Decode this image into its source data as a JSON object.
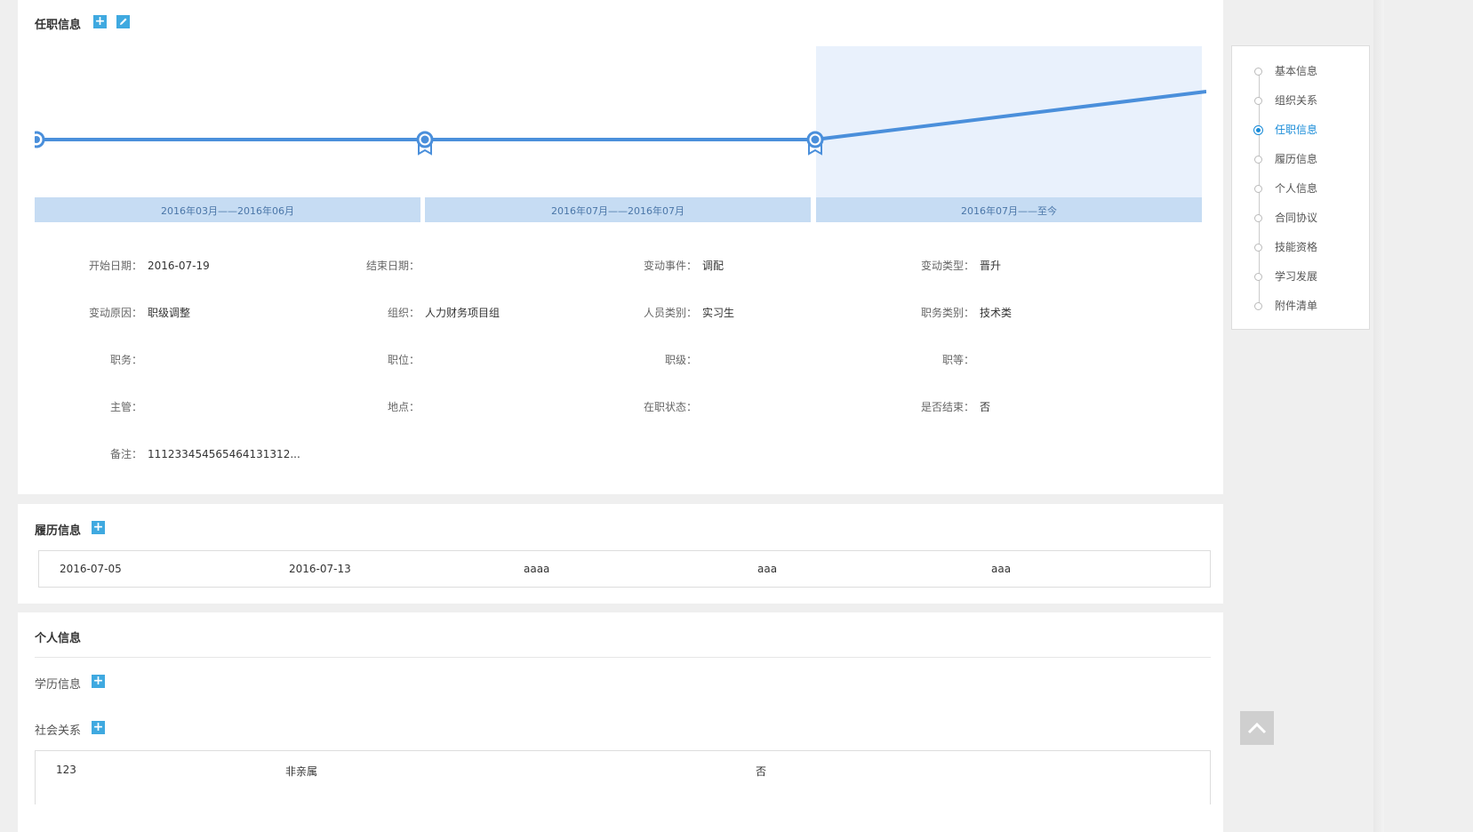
{
  "job_info": {
    "title": "任职信息",
    "add_icon": "plus-icon",
    "edit_icon": "pencil-icon",
    "timeline": {
      "segments": [
        "2016年03月——2016年06月",
        "2016年07月——2016年07月",
        "2016年07月——至今"
      ],
      "selected_index": 2
    },
    "fields": {
      "start_date": {
        "label": "开始日期：",
        "value": "2016-07-19"
      },
      "end_date": {
        "label": "结束日期：",
        "value": ""
      },
      "change_event": {
        "label": "变动事件：",
        "value": "调配"
      },
      "change_type": {
        "label": "变动类型：",
        "value": "晋升"
      },
      "change_reason": {
        "label": "变动原因：",
        "value": "职级调整"
      },
      "org": {
        "label": "组织：",
        "value": "人力财务项目组"
      },
      "staff_type": {
        "label": "人员类别：",
        "value": "实习生"
      },
      "duty_type": {
        "label": "职务类别：",
        "value": "技术类"
      },
      "duty": {
        "label": "职务：",
        "value": ""
      },
      "position": {
        "label": "职位：",
        "value": ""
      },
      "rank": {
        "label": "职级：",
        "value": ""
      },
      "grade": {
        "label": "职等：",
        "value": ""
      },
      "supervisor": {
        "label": "主管：",
        "value": ""
      },
      "location": {
        "label": "地点：",
        "value": ""
      },
      "status": {
        "label": "在职状态：",
        "value": ""
      },
      "ended": {
        "label": "是否结束：",
        "value": "否"
      },
      "remark": {
        "label": "备注：",
        "value": "111233454565464131312..."
      }
    }
  },
  "resume": {
    "title": "履历信息",
    "row": [
      "2016-07-05",
      "2016-07-13",
      "aaaa",
      "aaa",
      "aaa"
    ]
  },
  "personal": {
    "title": "个人信息",
    "education_label": "学历信息",
    "social_label": "社会关系",
    "social_row": [
      "123",
      "非亲属",
      "否"
    ]
  },
  "sidenav": {
    "items": [
      "基本信息",
      "组织关系",
      "任职信息",
      "履历信息",
      "个人信息",
      "合同协议",
      "技能资格",
      "学习发展",
      "附件清单"
    ],
    "active_index": 2
  },
  "colors": {
    "accent": "#3fa9e0",
    "timeline_line": "#4a8fdb",
    "segment_bg": "#c6dcf3",
    "active_nav": "#1a8cd8"
  }
}
